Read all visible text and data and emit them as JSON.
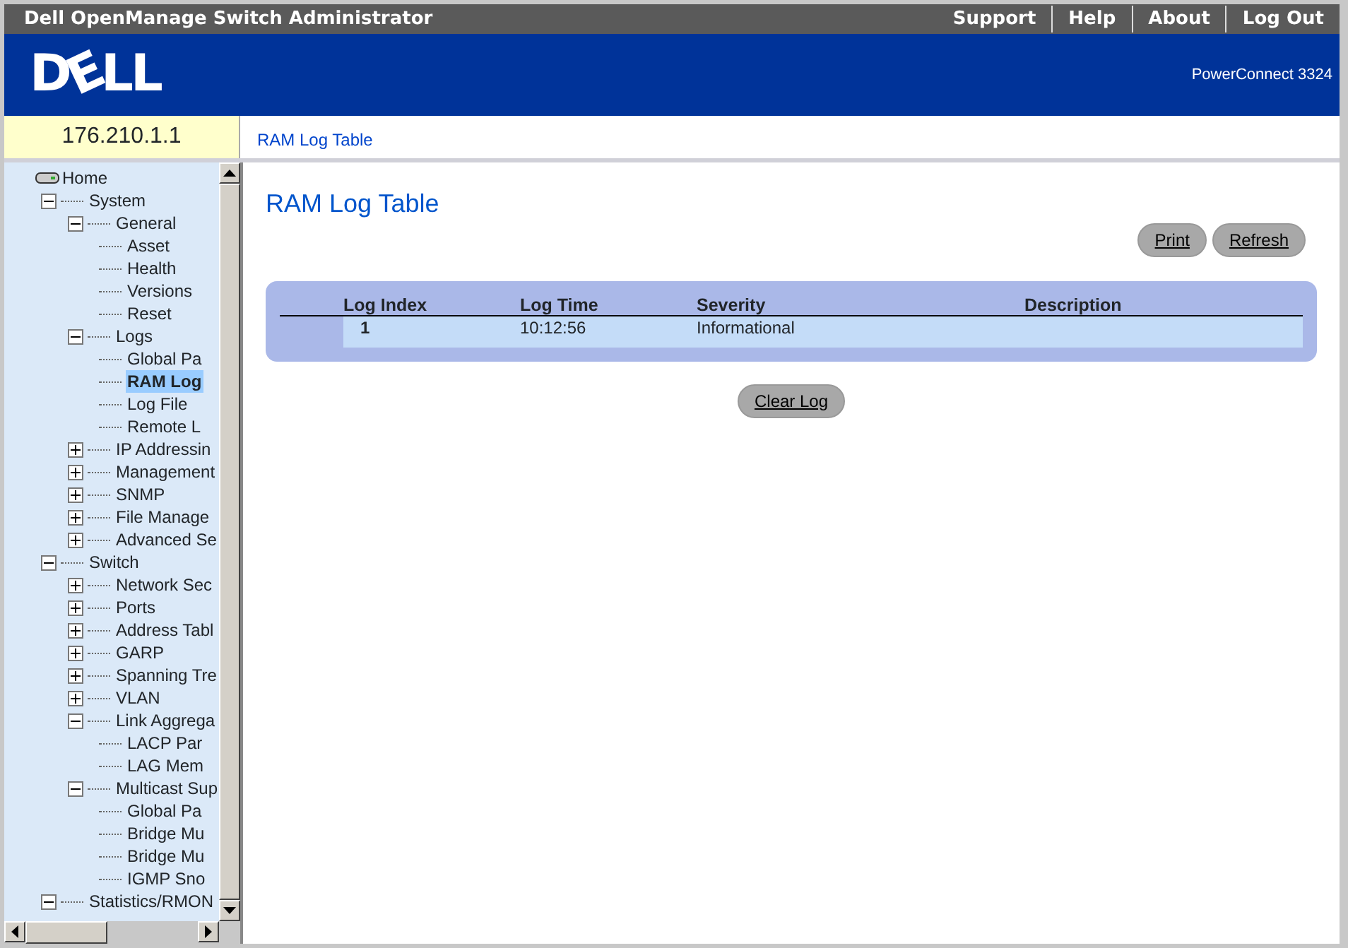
{
  "window": {
    "title": "Dell OpenManage Switch Administrator"
  },
  "top_links": [
    "Support",
    "Help",
    "About",
    "Log Out"
  ],
  "header": {
    "logo": "DELL",
    "product": "PowerConnect 3324"
  },
  "device_ip": "176.210.1.1",
  "breadcrumb": "RAM Log Table",
  "tree": [
    {
      "label": "Home",
      "kind": "root",
      "selected": false
    },
    {
      "label": "System",
      "kind": "folder",
      "expanded": true,
      "selected": false,
      "children": [
        {
          "label": "General",
          "kind": "folder",
          "expanded": true,
          "selected": false,
          "children": [
            {
              "label": "Asset",
              "kind": "leaf",
              "selected": false
            },
            {
              "label": "Health",
              "kind": "leaf",
              "selected": false
            },
            {
              "label": "Versions",
              "kind": "leaf",
              "selected": false
            },
            {
              "label": "Reset",
              "kind": "leaf",
              "selected": false
            }
          ]
        },
        {
          "label": "Logs",
          "kind": "folder",
          "expanded": true,
          "selected": false,
          "children": [
            {
              "label": "Global Pa",
              "kind": "leaf",
              "selected": false
            },
            {
              "label": "RAM Log",
              "kind": "leaf",
              "selected": true
            },
            {
              "label": "Log File",
              "kind": "leaf",
              "selected": false
            },
            {
              "label": "Remote L",
              "kind": "leaf",
              "selected": false
            }
          ]
        },
        {
          "label": "IP Addressin",
          "kind": "folder",
          "expanded": false,
          "selected": false
        },
        {
          "label": "Management",
          "kind": "folder",
          "expanded": false,
          "selected": false
        },
        {
          "label": "SNMP",
          "kind": "folder",
          "expanded": false,
          "selected": false
        },
        {
          "label": "File Manage",
          "kind": "folder",
          "expanded": false,
          "selected": false
        },
        {
          "label": "Advanced Se",
          "kind": "folder",
          "expanded": false,
          "selected": false
        }
      ]
    },
    {
      "label": "Switch",
      "kind": "folder",
      "expanded": true,
      "selected": false,
      "children": [
        {
          "label": "Network Sec",
          "kind": "folder",
          "expanded": false,
          "selected": false
        },
        {
          "label": "Ports",
          "kind": "folder",
          "expanded": false,
          "selected": false
        },
        {
          "label": "Address Tabl",
          "kind": "folder",
          "expanded": false,
          "selected": false
        },
        {
          "label": "GARP",
          "kind": "folder",
          "expanded": false,
          "selected": false
        },
        {
          "label": "Spanning Tre",
          "kind": "folder",
          "expanded": false,
          "selected": false
        },
        {
          "label": "VLAN",
          "kind": "folder",
          "expanded": false,
          "selected": false
        },
        {
          "label": "Link Aggrega",
          "kind": "folder",
          "expanded": true,
          "selected": false,
          "children": [
            {
              "label": "LACP Par",
              "kind": "leaf",
              "selected": false
            },
            {
              "label": "LAG Mem",
              "kind": "leaf",
              "selected": false
            }
          ]
        },
        {
          "label": "Multicast Sup",
          "kind": "folder",
          "expanded": true,
          "selected": false,
          "children": [
            {
              "label": "Global Pa",
              "kind": "leaf",
              "selected": false
            },
            {
              "label": "Bridge Mu",
              "kind": "leaf",
              "selected": false
            },
            {
              "label": "Bridge Mu",
              "kind": "leaf",
              "selected": false
            },
            {
              "label": "IGMP Sno",
              "kind": "leaf",
              "selected": false
            }
          ]
        }
      ]
    },
    {
      "label": "Statistics/RMON",
      "kind": "folder",
      "expanded": true,
      "selected": false
    }
  ],
  "page": {
    "title": "RAM Log Table",
    "buttons": [
      "Print",
      "Refresh"
    ],
    "table": {
      "columns": [
        "Log Index",
        "Log Time",
        "Severity",
        "Description"
      ],
      "rows": [
        {
          "log_index": "1",
          "log_time": "10:12:56",
          "severity": "Informational"
        }
      ]
    },
    "clear_button": "Clear Log"
  }
}
